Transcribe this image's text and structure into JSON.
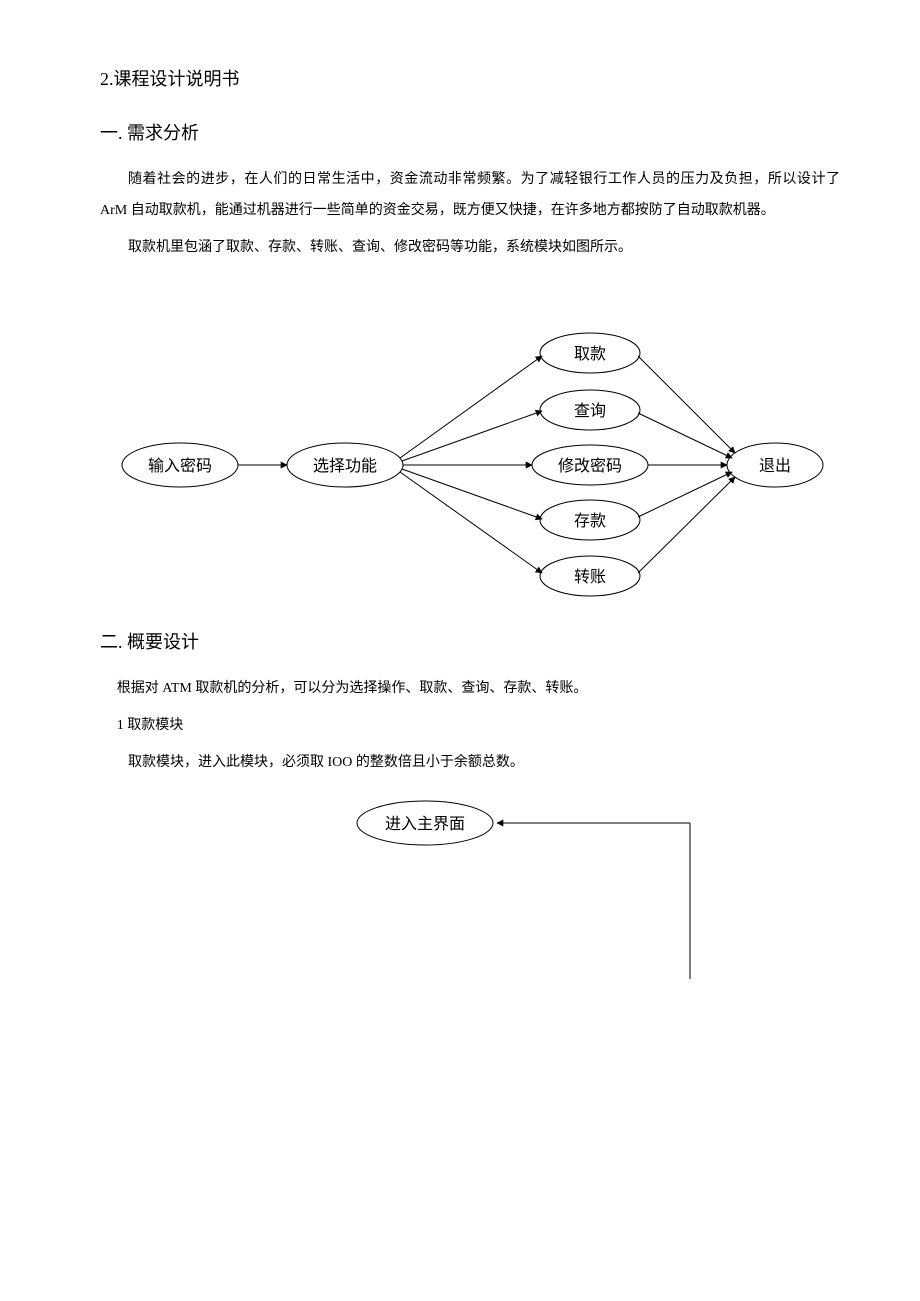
{
  "headings": {
    "main": "2.课程设计说明书",
    "section1": "一. 需求分析",
    "section2": "二. 概要设计"
  },
  "paragraphs": {
    "p1": "随着社会的进步，在人们的日常生活中，资金流动非常频繁。为了减轻银行工作人员的压力及负担，所以设计了 ArM 自动取款机，能通过机器进行一些简单的资金交易，既方便又快捷，在许多地方都按防了自动取款机器。",
    "p2": "取款机里包涵了取款、存款、转账、查询、修改密码等功能，系统模块如图所示。",
    "p3": "根据对 ATM 取款机的分析，可以分为选择操作、取款、查询、存款、转账。",
    "p4": "1 取款模块",
    "p5": "取款模块，进入此模块，必须取 IOO 的整数倍且小于余额总数。"
  },
  "diagram1": {
    "nodes": {
      "input_pwd": "输入密码",
      "select_fn": "选择功能",
      "withdraw": "取款",
      "query": "查询",
      "change_pwd": "修改密码",
      "deposit": "存款",
      "transfer": "转账",
      "exit": "退出"
    }
  },
  "diagram2": {
    "nodes": {
      "enter_main": "进入主界面"
    }
  }
}
